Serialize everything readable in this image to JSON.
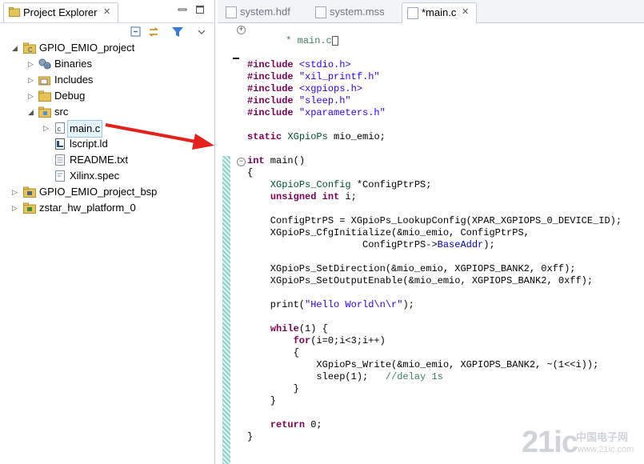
{
  "explorer": {
    "title": "Project Explorer",
    "tree": [
      {
        "label": "GPIO_EMIO_project",
        "type": "project",
        "expanded": true,
        "depth": 0
      },
      {
        "label": "Binaries",
        "type": "binaries",
        "expanded": false,
        "depth": 1
      },
      {
        "label": "Includes",
        "type": "includes",
        "expanded": false,
        "depth": 1
      },
      {
        "label": "Debug",
        "type": "folder",
        "expanded": false,
        "depth": 1
      },
      {
        "label": "src",
        "type": "folder",
        "expanded": true,
        "depth": 1
      },
      {
        "label": "main.c",
        "type": "c-file",
        "expanded": false,
        "depth": 2,
        "selected": true
      },
      {
        "label": "lscript.ld",
        "type": "ld-file",
        "depth": 2
      },
      {
        "label": "README.txt",
        "type": "text-file",
        "depth": 2
      },
      {
        "label": "Xilinx.spec",
        "type": "spec-file",
        "depth": 2
      },
      {
        "label": "GPIO_EMIO_project_bsp",
        "type": "bsp-project",
        "expanded": false,
        "depth": 0
      },
      {
        "label": "zstar_hw_platform_0",
        "type": "hw-project",
        "expanded": false,
        "depth": 0
      }
    ]
  },
  "editor": {
    "tabs": [
      {
        "label": "system.hdf",
        "active": false
      },
      {
        "label": "system.mss",
        "active": false
      },
      {
        "label": "*main.c",
        "active": true
      }
    ],
    "header_comment": "* main.c",
    "code": [
      "#include <stdio.h>",
      "#include \"xil_printf.h\"",
      "#include <xgpiops.h>",
      "#include \"sleep.h\"",
      "#include \"xparameters.h\"",
      "",
      "static XGpioPs mio_emio;",
      "",
      "int main()",
      "{",
      "    XGpioPs_Config *ConfigPtrPS;",
      "    unsigned int i;",
      "",
      "    ConfigPtrPS = XGpioPs_LookupConfig(XPAR_XGPIOPS_0_DEVICE_ID);",
      "    XGpioPs_CfgInitialize(&mio_emio, ConfigPtrPS,",
      "                    ConfigPtrPS->BaseAddr);",
      "",
      "    XGpioPs_SetDirection(&mio_emio, XGPIOPS_BANK2, 0xff);",
      "    XGpioPs_SetOutputEnable(&mio_emio, XGPIOPS_BANK2, 0xff);",
      "",
      "    print(\"Hello World\\n\\r\");",
      "",
      "    while(1) {",
      "        for(i=0;i<3;i++)",
      "        {",
      "            XGpioPs_Write(&mio_emio, XGPIOPS_BANK2, ~(1<<i));",
      "            sleep(1);   //delay 1s",
      "        }",
      "    }",
      "",
      "    return 0;",
      "}"
    ]
  },
  "watermark": {
    "brand": "21ic",
    "cn": "中国电子网",
    "url": "www.21ic.com"
  },
  "colors": {
    "arrow": "#e3221b",
    "keyword": "#7f0055",
    "string": "#2a00ff",
    "comment": "#3f7f5f",
    "type": "#005032"
  }
}
